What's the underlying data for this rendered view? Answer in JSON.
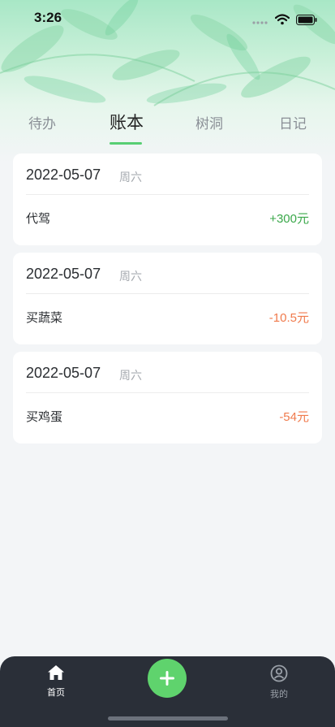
{
  "status": {
    "time": "3:26"
  },
  "tabs": [
    {
      "label": "待办"
    },
    {
      "label": "账本"
    },
    {
      "label": "树洞"
    },
    {
      "label": "日记"
    }
  ],
  "entries": [
    {
      "date": "2022-05-07",
      "weekday": "周六",
      "item": "代驾",
      "amount": "+300元"
    },
    {
      "date": "2022-05-07",
      "weekday": "周六",
      "item": "买蔬菜",
      "amount": "-10.5元"
    },
    {
      "date": "2022-05-07",
      "weekday": "周六",
      "item": "买鸡蛋",
      "amount": "-54元"
    }
  ],
  "bottom_nav": {
    "home_label": "首页",
    "mine_label": "我的"
  },
  "colors": {
    "accent": "#58cf73",
    "income": "#3aa84a",
    "expense": "#f07a4c",
    "nav_bg": "#2a2f38"
  }
}
